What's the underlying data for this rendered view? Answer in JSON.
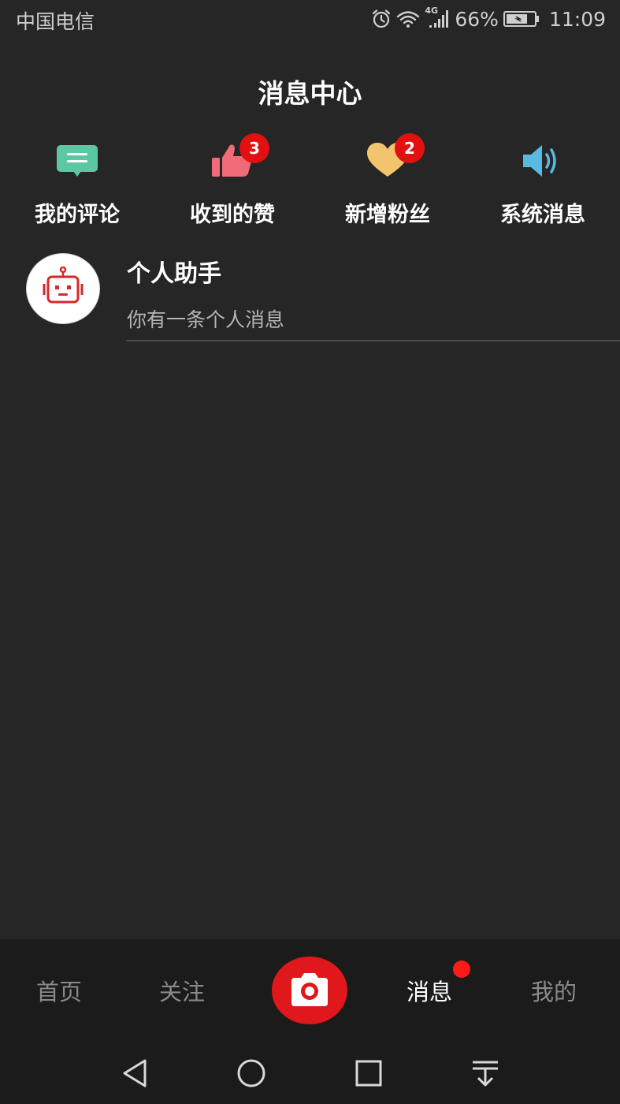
{
  "status_bar": {
    "carrier": "中国电信",
    "network": "4G",
    "battery_percent": "66%",
    "time": "11:09",
    "icons": [
      "alarm-icon",
      "wifi-icon",
      "signal-icon",
      "battery-icon"
    ]
  },
  "header": {
    "title": "消息中心"
  },
  "categories": [
    {
      "label": "我的评论",
      "icon": "comment-icon",
      "color": "#5cc8a3",
      "badge": null
    },
    {
      "label": "收到的赞",
      "icon": "thumbs-up-icon",
      "color": "#f06a78",
      "badge": "3"
    },
    {
      "label": "新增粉丝",
      "icon": "heart-icon",
      "color": "#f3c46e",
      "badge": "2"
    },
    {
      "label": "系统消息",
      "icon": "speaker-icon",
      "color": "#5ab9e3",
      "badge": null
    }
  ],
  "messages": [
    {
      "title": "个人助手",
      "preview": "你有一条个人消息",
      "avatar_icon": "robot-icon"
    }
  ],
  "tab_bar": {
    "tabs": [
      "首页",
      "关注",
      "消息",
      "我的"
    ],
    "active": "消息",
    "center_icon": "camera-icon",
    "accent_color": "#e0171b"
  },
  "nav_bar": {
    "icons": [
      "back-icon",
      "home-icon",
      "recents-icon",
      "notification-pull-icon"
    ]
  }
}
